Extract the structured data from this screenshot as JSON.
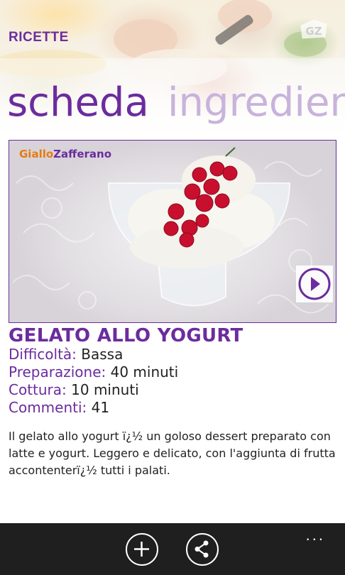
{
  "header": {
    "app_title": "RICETTE",
    "logo_text": "GZ"
  },
  "pivot": {
    "active": "scheda",
    "next": "ingredien"
  },
  "photo": {
    "brand_part1": "Giallo",
    "brand_part2": "Zafferano",
    "play_icon": "play-icon"
  },
  "recipe": {
    "title": "GELATO ALLO YOGURT",
    "meta": [
      {
        "label": "Difficoltà:",
        "value": " Bassa"
      },
      {
        "label": "Preparazione:",
        "value": " 40 minuti"
      },
      {
        "label": "Cottura:",
        "value": " 10 minuti"
      },
      {
        "label": "Commenti:",
        "value": " 41"
      }
    ],
    "description": "Il gelato allo yogurt ï¿½ un goloso dessert preparato con latte e yogurt. Leggero e delicato, con l'aggiunta di frutta accontenterï¿½ tutti i palati."
  },
  "appbar": {
    "add_icon": "add-icon",
    "share_icon": "share-icon",
    "more": "..."
  },
  "colors": {
    "accent": "#6b2c9e",
    "pivot_inactive": "#c8b3dc",
    "appbar_bg": "#1f1f1f",
    "brand_orange": "#e87a12"
  }
}
